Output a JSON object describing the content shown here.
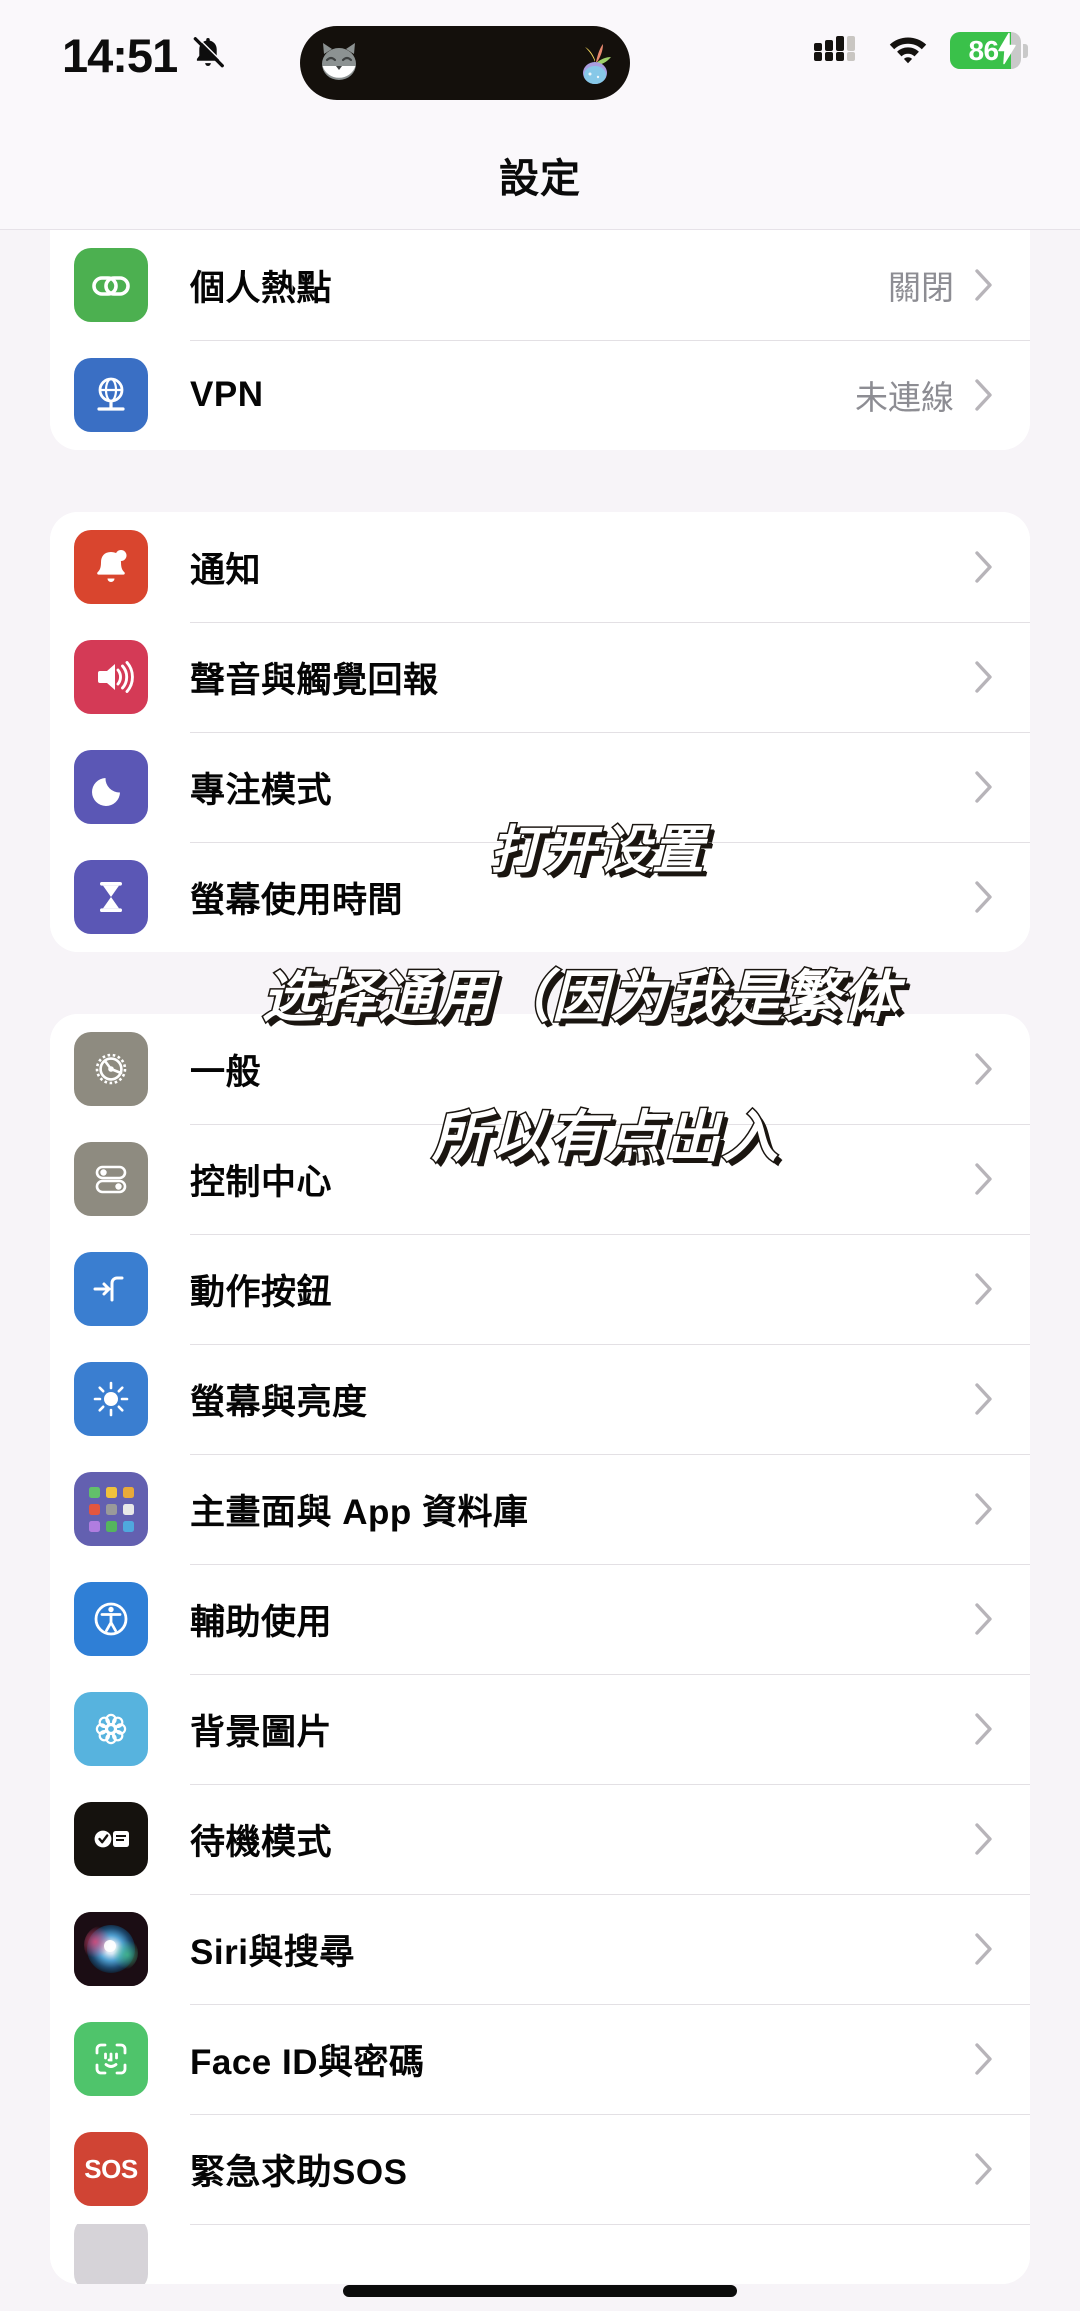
{
  "status_bar": {
    "time": "14:51",
    "silent_icon": "bell-slash-icon",
    "dynamic_island": {
      "left_icon": "cat-face-icon",
      "right_icon": "plant-sprout-icon"
    },
    "signal_icon": "cellular-signal-icon",
    "wifi_icon": "wifi-icon",
    "battery": {
      "percent": "86",
      "level": 86,
      "charging": true,
      "color": "#3ac14a"
    }
  },
  "header": {
    "title": "設定"
  },
  "groups": [
    {
      "id": "connectivity",
      "rows": [
        {
          "label": "個人熱點",
          "value": "關閉",
          "icon": "hotspot-icon",
          "icon_color": "#4cb050"
        },
        {
          "label": "VPN",
          "value": "未連線",
          "icon": "vpn-globe-icon",
          "icon_color": "#3a6fc4"
        }
      ]
    },
    {
      "id": "alerts",
      "rows": [
        {
          "label": "通知",
          "value": "",
          "icon": "bell-icon",
          "icon_color": "#d9452e"
        },
        {
          "label": "聲音與觸覺回報",
          "value": "",
          "icon": "speaker-waves-icon",
          "icon_color": "#d43a56"
        },
        {
          "label": "專注模式",
          "value": "",
          "icon": "moon-icon",
          "icon_color": "#5b57b5"
        },
        {
          "label": "螢幕使用時間",
          "value": "",
          "icon": "hourglass-icon",
          "icon_color": "#5b57b5"
        }
      ]
    },
    {
      "id": "system",
      "rows": [
        {
          "label": "一般",
          "value": "",
          "icon": "gear-icon",
          "icon_color": "#8e8b80"
        },
        {
          "label": "控制中心",
          "value": "",
          "icon": "control-center-icon",
          "icon_color": "#8e8b80"
        },
        {
          "label": "動作按鈕",
          "value": "",
          "icon": "action-button-icon",
          "icon_color": "#3a7ed0"
        },
        {
          "label": "螢幕與亮度",
          "value": "",
          "icon": "brightness-icon",
          "icon_color": "#3a7ed0"
        },
        {
          "label": "主畫面與 App 資料庫",
          "value": "",
          "icon": "app-grid-icon",
          "icon_color": "#6360b0"
        },
        {
          "label": "輔助使用",
          "value": "",
          "icon": "accessibility-icon",
          "icon_color": "#2f7fd6"
        },
        {
          "label": "背景圖片",
          "value": "",
          "icon": "wallpaper-flower-icon",
          "icon_color": "#57b3de"
        },
        {
          "label": "待機模式",
          "value": "",
          "icon": "standby-icon",
          "icon_color": "#15120e"
        },
        {
          "label": "Siri與搜尋",
          "value": "",
          "icon": "siri-orb-icon",
          "icon_color": "#2a1620"
        },
        {
          "label": "Face ID與密碼",
          "value": "",
          "icon": "face-id-icon",
          "icon_color": "#4fc46b"
        },
        {
          "label": "緊急求助SOS",
          "value": "",
          "icon": "sos-icon",
          "icon_color": "#d04434"
        }
      ]
    }
  ],
  "annotations": [
    "打开设置",
    "选择通用（因为我是繁体",
    "所以有点出入"
  ],
  "home_indicator": "home-indicator"
}
